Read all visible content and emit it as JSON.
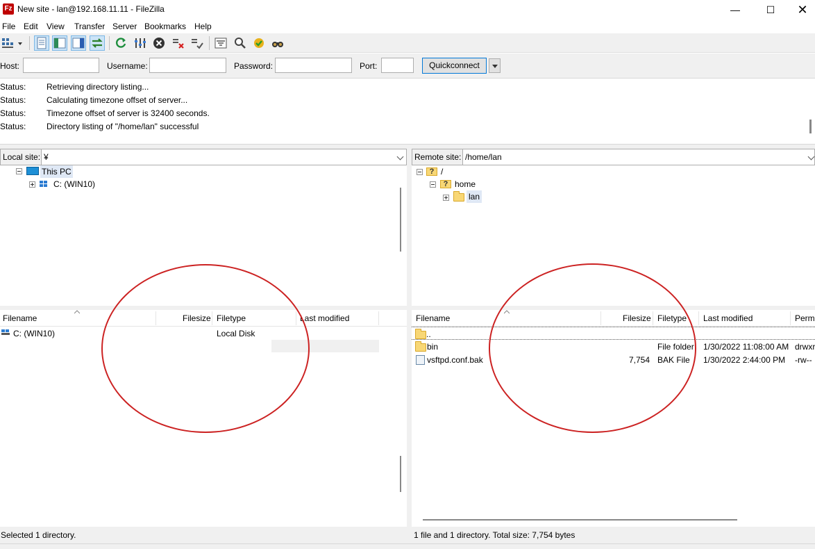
{
  "window": {
    "title": "New site - lan@192.168.11.11 - FileZilla",
    "icon_text": "Fz",
    "controls": {
      "minimize": "—",
      "maximize": "☐",
      "close": "✕"
    }
  },
  "menu": [
    "File",
    "Edit",
    "View",
    "Transfer",
    "Server",
    "Bookmarks",
    "Help"
  ],
  "toolbar": {
    "icons": [
      "site-manager-icon",
      "dropdown-icon",
      "toggle-log-icon",
      "toggle-local-tree-icon",
      "toggle-remote-tree-icon",
      "toggle-transfer-queue-icon",
      "refresh-icon",
      "process-queue-icon",
      "cancel-icon",
      "disconnect-icon",
      "reconnect-icon",
      "directory-filter-icon",
      "search-icon",
      "sync-browsing-icon",
      "find-files-icon"
    ]
  },
  "quickconnect": {
    "host_label": "Host:",
    "username_label": "Username:",
    "password_label": "Password:",
    "port_label": "Port:",
    "host_value": "",
    "username_value": "",
    "password_value": "",
    "port_value": "",
    "button_label": "Quickconnect"
  },
  "log": [
    {
      "key": "Status:",
      "value": "Retrieving directory listing..."
    },
    {
      "key": "Status:",
      "value": "Calculating timezone offset of server..."
    },
    {
      "key": "Status:",
      "value": "Timezone offset of server is 32400 seconds."
    },
    {
      "key": "Status:",
      "value": "Directory listing of \"/home/lan\" successful"
    }
  ],
  "local": {
    "site_label": "Local site:",
    "site_value": "¥",
    "tree": [
      {
        "label": "This PC"
      },
      {
        "label": "C: (WIN10)"
      }
    ],
    "columns": [
      "Filename",
      "Filesize",
      "Filetype",
      "Last modified"
    ],
    "rows": [
      {
        "name": "C: (WIN10)",
        "size": "",
        "type": "Local Disk",
        "modified": ""
      }
    ],
    "status": "Selected 1 directory."
  },
  "remote": {
    "site_label": "Remote site:",
    "site_value": "/home/lan",
    "tree": [
      {
        "label": "/"
      },
      {
        "label": "home"
      },
      {
        "label": "lan"
      }
    ],
    "columns": [
      "Filename",
      "Filesize",
      "Filetype",
      "Last modified",
      "Permi"
    ],
    "rows": [
      {
        "name": "..",
        "size": "",
        "type": "",
        "modified": "",
        "perms": ""
      },
      {
        "name": "bin",
        "size": "",
        "type": "File folder",
        "modified": "1/30/2022 11:08:00 AM",
        "perms": "drwxr"
      },
      {
        "name": "vsftpd.conf.bak",
        "size": "7,754",
        "type": "BAK File",
        "modified": "1/30/2022 2:44:00 PM",
        "perms": "-rw--"
      }
    ],
    "status": "1 file and 1 directory. Total size: 7,754 bytes"
  },
  "colors": {
    "annotation_circle": "#cc2222",
    "accent": "#0078d7",
    "chrome": "#f0f0f0"
  }
}
